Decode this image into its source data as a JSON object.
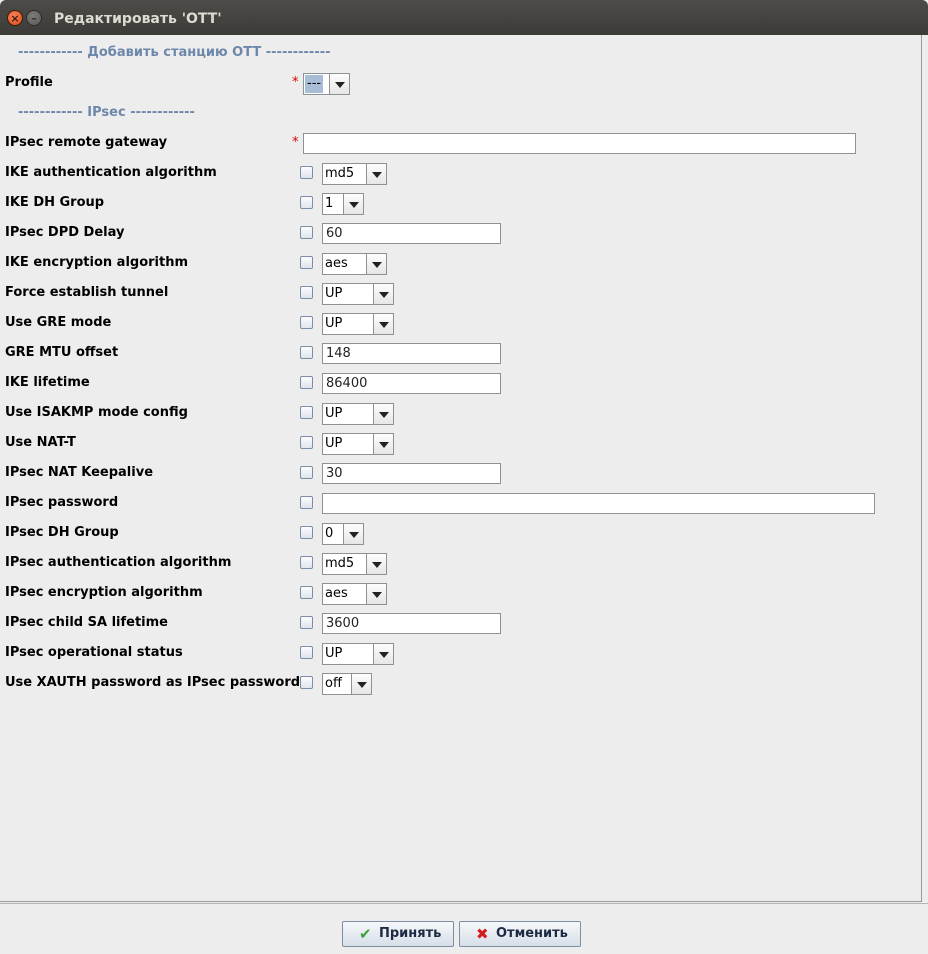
{
  "window": {
    "title": "Редактировать 'OTT'",
    "close_glyph": "×",
    "minimize_glyph": "–"
  },
  "sections": {
    "add_station": "------------ Добавить станцию OTT ------------",
    "ipsec": "------------ IPsec ------------"
  },
  "profile": {
    "label": "Profile",
    "value": "---",
    "required": "*"
  },
  "gateway": {
    "label": "IPsec remote gateway",
    "value": "",
    "required": "*"
  },
  "fields": [
    {
      "label": "IKE authentication algorithm",
      "kind": "combo",
      "value": "md5"
    },
    {
      "label": "IKE DH Group",
      "kind": "combo",
      "value": "1"
    },
    {
      "label": "IPsec DPD Delay",
      "kind": "text",
      "value": "60"
    },
    {
      "label": "IKE encryption algorithm",
      "kind": "combo",
      "value": "aes"
    },
    {
      "label": "Force establish tunnel",
      "kind": "combo",
      "value": "UP"
    },
    {
      "label": "Use GRE mode",
      "kind": "combo",
      "value": "UP"
    },
    {
      "label": "GRE MTU offset",
      "kind": "text",
      "value": "148"
    },
    {
      "label": "IKE lifetime",
      "kind": "text",
      "value": "86400"
    },
    {
      "label": "Use ISAKMP mode config",
      "kind": "combo",
      "value": "UP"
    },
    {
      "label": "Use NAT-T",
      "kind": "combo",
      "value": "UP"
    },
    {
      "label": "IPsec NAT Keepalive",
      "kind": "text",
      "value": "30"
    },
    {
      "label": "IPsec password",
      "kind": "text",
      "value": ""
    },
    {
      "label": "IPsec DH Group",
      "kind": "combo",
      "value": "0"
    },
    {
      "label": "IPsec authentication algorithm",
      "kind": "combo",
      "value": "md5"
    },
    {
      "label": "IPsec encryption algorithm",
      "kind": "combo",
      "value": "aes"
    },
    {
      "label": "IPsec child SA lifetime",
      "kind": "text",
      "value": "3600"
    },
    {
      "label": "IPsec operational status",
      "kind": "combo",
      "value": "UP"
    },
    {
      "label": "Use XAUTH password as IPsec password",
      "kind": "combo",
      "value": "off"
    }
  ],
  "buttons": {
    "ok_label": "Принять",
    "ok_icon": "checkmark-icon",
    "cancel_label": "Отменить",
    "cancel_icon": "cross-icon"
  },
  "colors": {
    "section_header": "#6d87ab",
    "required": "#d40000",
    "titlebar": "#3c3b37"
  }
}
